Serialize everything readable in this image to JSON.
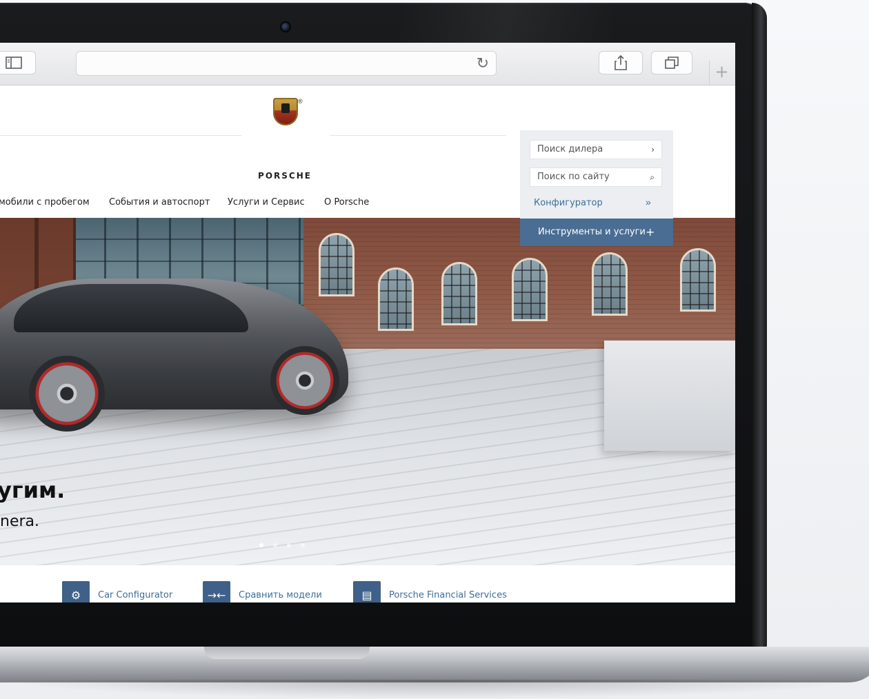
{
  "browser": {
    "reload_icon": "reload-icon",
    "share_icon": "share-icon",
    "tabs_icon": "tabs-icon",
    "sidebar_icon": "sidebar-icon",
    "new_tab_label": "+"
  },
  "brand": {
    "wordmark": "PORSCHE",
    "registered": "®"
  },
  "nav": {
    "items": [
      "мобили с пробегом",
      "События и автоспорт",
      "Услуги и Сервис",
      "О Porsche"
    ]
  },
  "side_panel": {
    "dealer_search": "Поиск дилера",
    "dealer_search_icon": "›",
    "site_search": "Поиск по сайту",
    "site_search_icon": "⌕",
    "configurator": "Конфигуратор",
    "configurator_icon": "»",
    "tools": "Инструменты и услуги",
    "tools_icon": "+"
  },
  "hero": {
    "title": "угим.",
    "subtitle": "nera."
  },
  "quick_links": [
    {
      "label": "Car Configurator",
      "icon": "⚙"
    },
    {
      "label": "Сравнить модели",
      "icon": "→←"
    },
    {
      "label": "Porsche Financial Services",
      "icon": "▤"
    }
  ],
  "colors": {
    "accent": "#3f6088",
    "link": "#3c6e9c",
    "tools_bar": "#4a6d94"
  }
}
